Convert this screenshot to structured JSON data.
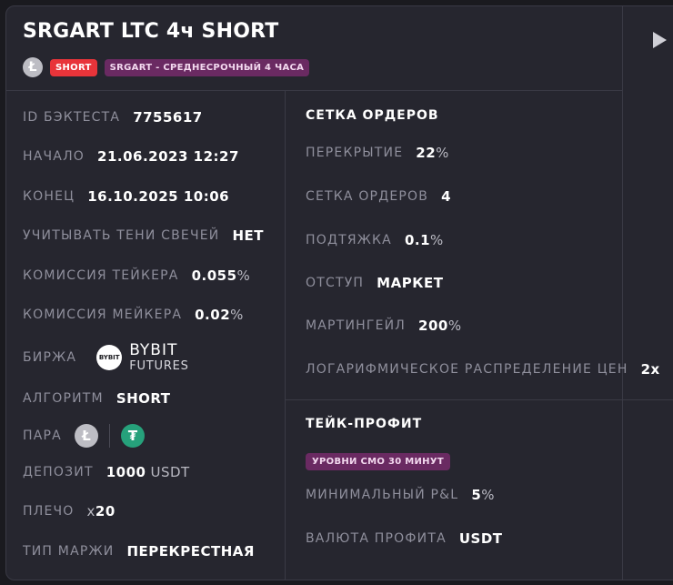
{
  "header": {
    "title": "SRGART LTC 4ч SHORT",
    "coin_icon": "litecoin-icon",
    "side_badge": "SHORT",
    "strategy_badge": "SRGART - СРЕДНЕСРОЧНЫЙ 4 ЧАСА",
    "play_icon": "play-icon"
  },
  "left": {
    "backtest_id": {
      "label": "ID БЭКТЕСТА",
      "value": "7755617"
    },
    "start": {
      "label": "НАЧАЛО",
      "value": "21.06.2023 12:27"
    },
    "end": {
      "label": "КОНЕЦ",
      "value": "16.10.2025 10:06"
    },
    "wicks": {
      "label": "УЧИТЫВАТЬ ТЕНИ СВЕЧЕЙ",
      "value": "НЕТ"
    },
    "taker_fee": {
      "label": "КОМИССИЯ ТЕЙКЕРА",
      "value": "0.055",
      "suffix": "%"
    },
    "maker_fee": {
      "label": "КОМИССИЯ МЕЙКЕРА",
      "value": "0.02",
      "suffix": "%"
    },
    "exchange": {
      "label": "БИРЖА",
      "logo_text": "BYBIT",
      "name": "BYBIT",
      "subname": "FUTURES"
    },
    "algorithm": {
      "label": "АЛГОРИТМ",
      "value": "SHORT"
    },
    "pair": {
      "label": "ПАРА",
      "base_icon": "litecoin-icon",
      "quote_icon": "tether-icon"
    },
    "deposit": {
      "label": "ДЕПОЗИТ",
      "value": "1000",
      "unit": "USDT"
    },
    "leverage": {
      "label": "ПЛЕЧО",
      "prefix": "x",
      "value": "20"
    },
    "margin_type": {
      "label": "ТИП МАРЖИ",
      "value": "ПЕРЕКРЕСТНАЯ"
    }
  },
  "grid": {
    "title": "СЕТКА ОРДЕРОВ",
    "overlap": {
      "label": "ПЕРЕКРЫТИЕ",
      "value": "22",
      "suffix": "%"
    },
    "orders": {
      "label": "СЕТКА ОРДЕРОВ",
      "value": "4"
    },
    "pullup": {
      "label": "ПОДТЯЖКА",
      "value": "0.1",
      "suffix": "%"
    },
    "offset": {
      "label": "ОТСТУП",
      "value": "МАРКЕТ"
    },
    "martingale": {
      "label": "МАРТИНГЕЙЛ",
      "value": "200",
      "suffix": "%"
    },
    "log_dist": {
      "label": "ЛОГАРИФМИЧЕСКОЕ РАСПРЕДЕЛЕНИЕ ЦЕН",
      "value": "2x"
    }
  },
  "take_profit": {
    "title": "ТЕЙК-ПРОФИТ",
    "badge": "УРОВНИ СМО 30 МИНУТ",
    "min_pnl": {
      "label": "МИНИМАЛЬНЫЙ P&L",
      "value": "5",
      "suffix": "%"
    },
    "currency": {
      "label": "ВАЛЮТА ПРОФИТА",
      "value": "USDT"
    }
  },
  "colors": {
    "background": "#26262f",
    "short": "#e8343a",
    "strategy_badge": "#6a2a62",
    "tether": "#26a17b",
    "label": "#8f8f9c"
  }
}
